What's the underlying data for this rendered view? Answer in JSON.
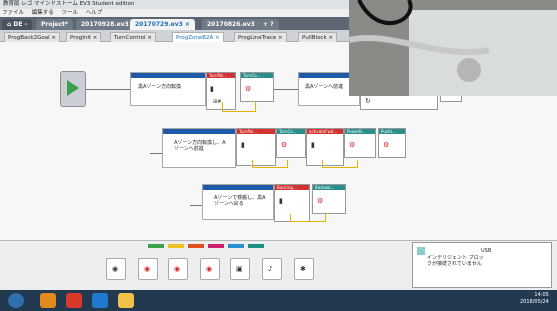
{
  "titlebar": {
    "title": "教育版 レゴ マインドストーム EV3 Student edition"
  },
  "menubar": {
    "items": [
      "ファイル",
      "編集する",
      "ツール",
      "ヘルプ"
    ]
  },
  "project_tabs": {
    "home": "⌂ DE -",
    "tabs": [
      {
        "label": "Project*"
      },
      {
        "label": "20170928.ev3 ×"
      },
      {
        "label": "20170729.ev3 ×"
      },
      {
        "label": "20170826.ev3 ×"
      },
      {
        "label": "+ ?"
      }
    ]
  },
  "program_tabs": [
    {
      "label": "ProgBack2Goal ×"
    },
    {
      "label": "ProgInit ×"
    },
    {
      "label": "TurnControl ×"
    },
    {
      "label": "ProgZoneB2A ×"
    },
    {
      "label": "ProgLineTrace ×"
    },
    {
      "label": "PullBlock ×"
    }
  ],
  "comments": {
    "c1": "黒Aゾーン方向転換",
    "c2": "黒Aゾーンへ前進",
    "c3": "Aゾーン方向転換し、Aゾーンへ前進",
    "c4": "Aゾーンで検搬し、黒Aゾーンへ戻る"
  },
  "blocks": {
    "b1": "TurnPoi...",
    "b2": "TurnCo...",
    "b3": "TurnPoi...",
    "b4": "TurnCo...",
    "b5": "activateFwd...",
    "b6": "PowerB...",
    "b7": "PushL...",
    "b8": "Backing...",
    "b9": "Backwa..."
  },
  "palette": {
    "swatches": [
      "#3aa04a",
      "#f0c020",
      "#e05020",
      "#d02070",
      "#2a8fd0",
      "#1a9080"
    ]
  },
  "hub": {
    "status_text": "インテリジェント ブロックが接続されていません",
    "usb": "USB"
  },
  "taskbar": {
    "time": "14:05",
    "date": "2018/05/24"
  }
}
